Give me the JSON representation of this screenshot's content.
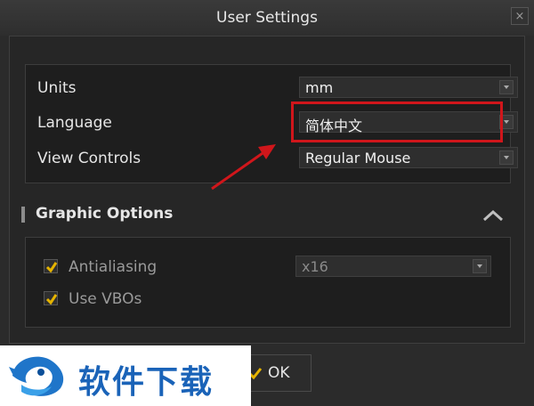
{
  "window": {
    "title": "User Settings",
    "close_glyph": "×"
  },
  "general": {
    "rows": [
      {
        "label": "Units",
        "value": "mm"
      },
      {
        "label": "Language",
        "value": "简体中文"
      },
      {
        "label": "View Controls",
        "value": "Regular Mouse"
      }
    ]
  },
  "graphic": {
    "title": "Graphic Options",
    "antialiasing_label": "Antialiasing",
    "antialiasing_checked": true,
    "antialiasing_value": "x16",
    "vbo_label": "Use VBOs",
    "vbo_checked": true
  },
  "footer": {
    "ok_label": "OK"
  },
  "watermark": {
    "text": "软件下载"
  },
  "colors": {
    "highlight": "#d0161b",
    "checkmark": "#e6b400",
    "background": "#2b2b2b"
  }
}
